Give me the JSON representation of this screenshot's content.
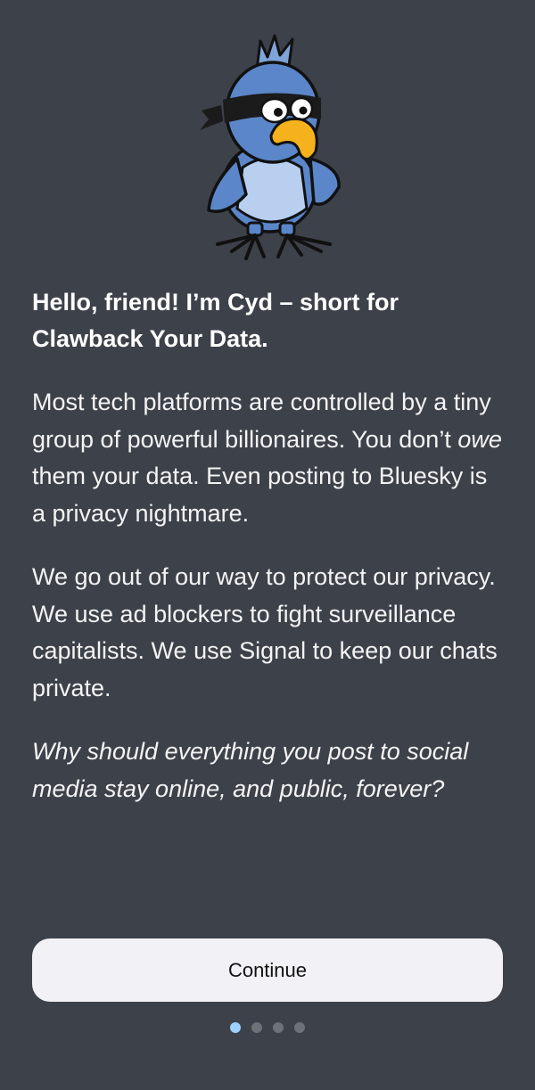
{
  "headline": "Hello, friend! I’m Cyd – short for Clawback Your Data.",
  "paragraph1": {
    "part1": "Most tech platforms are controlled by a tiny group of powerful billionaires. You don’t ",
    "emphasis": "owe",
    "part2": " them your data. Even posting to Bluesky is a privacy nightmare."
  },
  "paragraph2": "We go out of our way to protect our privacy. We use ad blockers to fight surveillance capitalists. We use Signal to keep our chats private.",
  "paragraph3": "Why should everything you post to social media stay online, and public, forever?",
  "continue_label": "Continue",
  "pagination": {
    "total": 4,
    "active": 1
  },
  "colors": {
    "background": "#3d414a",
    "button": "#f2f2f6",
    "dot_active": "#9fd0ff",
    "dot_inactive": "#6d717a"
  },
  "icons": {
    "mascot": "cyd-bird-mascot-icon"
  }
}
